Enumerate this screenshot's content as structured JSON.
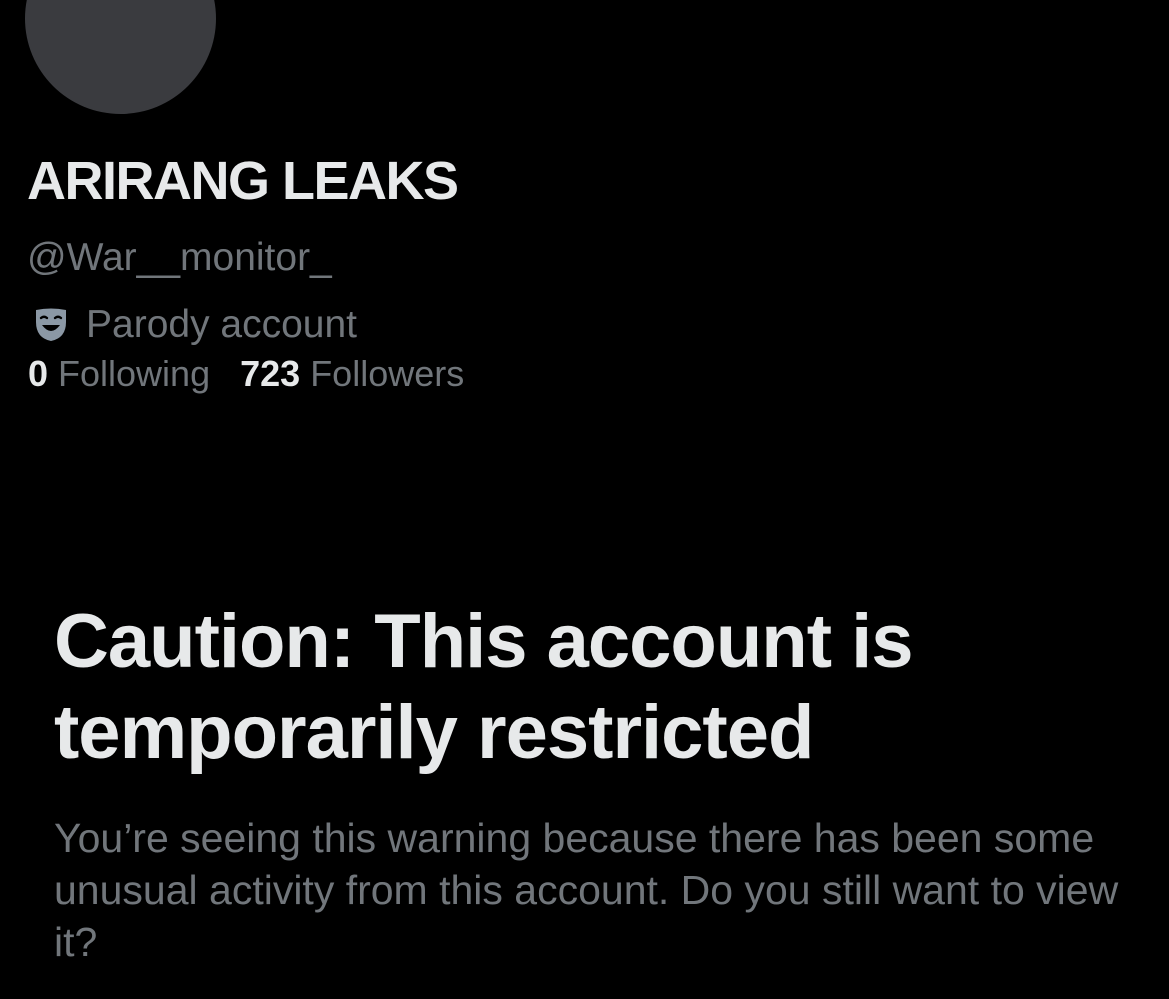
{
  "profile": {
    "display_name": "ARIRANG LEAKS",
    "handle": "@War__monitor_",
    "label": {
      "icon": "theater-mask-icon",
      "text": "Parody account"
    },
    "stats": {
      "following_count": "0",
      "following_label": "Following",
      "followers_count": "723",
      "followers_label": "Followers"
    }
  },
  "warning": {
    "title": "Caution: This account is temporarily restricted",
    "message": "You’re seeing this warning because there has been some unusual activity from this account. Do you still want to view it?"
  },
  "colors": {
    "background": "#000000",
    "primary_text": "#e7e9ea",
    "secondary_text": "#71767b",
    "avatar_placeholder": "#3a3b3f",
    "mask_icon": "#8b98a5"
  }
}
